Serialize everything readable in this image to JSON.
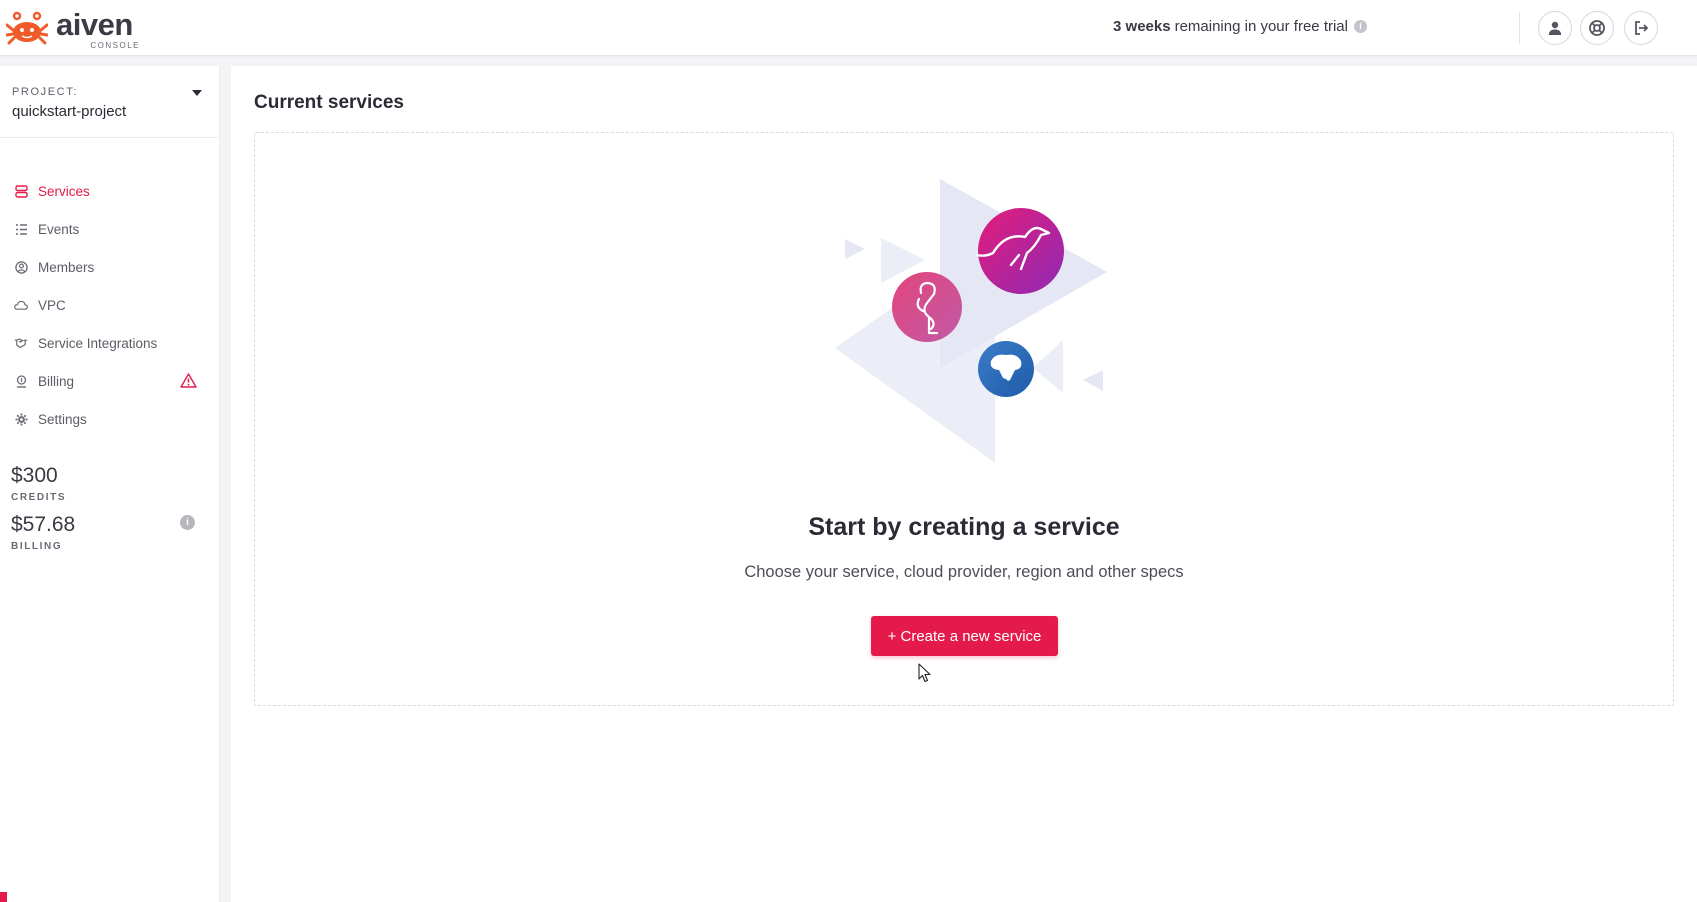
{
  "header": {
    "logo_text": "aiven",
    "logo_subtext": "CONSOLE",
    "trial_bold": "3 weeks",
    "trial_rest": "remaining in your free trial",
    "trial_info_glyph": "i",
    "icons": [
      "user-icon",
      "support-icon",
      "logout-icon"
    ]
  },
  "sidebar": {
    "project_label": "PROJECT:",
    "project_name": "quickstart-project",
    "items": [
      {
        "label": "Services",
        "icon": "services-icon",
        "active": true
      },
      {
        "label": "Events",
        "icon": "events-icon"
      },
      {
        "label": "Members",
        "icon": "members-icon"
      },
      {
        "label": "VPC",
        "icon": "cloud-icon"
      },
      {
        "label": "Service Integrations",
        "icon": "handshake-icon"
      },
      {
        "label": "Billing",
        "icon": "billing-icon",
        "alert": "warning-icon"
      },
      {
        "label": "Settings",
        "icon": "gear-icon"
      }
    ],
    "credits_amount": "$300",
    "credits_label": "CREDITS",
    "billing_amount": "$57.68",
    "billing_label": "BILLING",
    "billing_info_glyph": "i"
  },
  "main": {
    "title": "Current services",
    "empty_title": "Start by creating a service",
    "empty_subtitle": "Choose your service, cloud provider, region and other specs",
    "create_button": "+ Create a new service"
  },
  "colors": {
    "accent": "#e41a4a",
    "text_dark": "#2b2b35",
    "kafka_gradient": [
      "#e31c79",
      "#8f2ab5"
    ],
    "flink_gradient": [
      "#e3457a",
      "#c05aa8"
    ],
    "postgres_gradient": [
      "#3a7cc8",
      "#1f5ba8"
    ]
  }
}
